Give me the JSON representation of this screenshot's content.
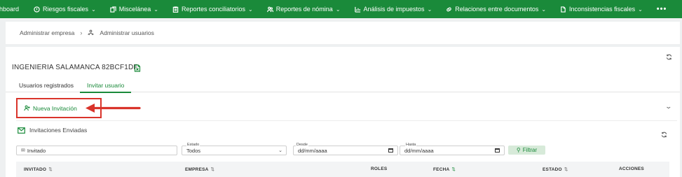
{
  "topnav": {
    "items": [
      {
        "label": "hboard",
        "icon": "dashboard-icon",
        "chevron": false
      },
      {
        "label": "Riesgos fiscales",
        "icon": "risk-icon",
        "chevron": true
      },
      {
        "label": "Miscelánea",
        "icon": "copy-icon",
        "chevron": true
      },
      {
        "label": "Reportes conciliatorios",
        "icon": "clipboard-icon",
        "chevron": true
      },
      {
        "label": "Reportes de nómina",
        "icon": "people-icon",
        "chevron": true
      },
      {
        "label": "Análisis de impuestos",
        "icon": "analysis-icon",
        "chevron": true
      },
      {
        "label": "Relaciones entre documentos",
        "icon": "link-icon",
        "chevron": true
      },
      {
        "label": "Inconsistencias fiscales",
        "icon": "document-icon",
        "chevron": true
      }
    ],
    "more": "•••"
  },
  "breadcrumb": {
    "first": "Administrar empresa",
    "sep": "›",
    "second": "Administrar usuarios"
  },
  "company": "INGENIERIA SALAMANCA 82BCF1DF",
  "tabs": {
    "registered": "Usuarios registrados",
    "invite": "Invitar usuario"
  },
  "invite_button": "Nueva Invitación",
  "section_title": "Invitaciones Enviadas",
  "filters": {
    "invited_placeholder": "Invitado",
    "estado_label": "Estado",
    "estado_value": "Todos",
    "desde_label": "Desde",
    "desde_value": "dd/mm/aaaa",
    "hasta_label": "Hasta",
    "hasta_value": "dd/mm/aaaa",
    "filter_button": "Filtrar"
  },
  "table": {
    "headers": {
      "invitado": "INVITADO",
      "empresa": "EMPRESA",
      "roles": "ROLES",
      "fecha": "FECHA",
      "estado": "ESTADO",
      "acciones": "ACCIONES"
    }
  },
  "colors": {
    "brand": "#1a8a3a",
    "highlight": "#d9342b"
  }
}
